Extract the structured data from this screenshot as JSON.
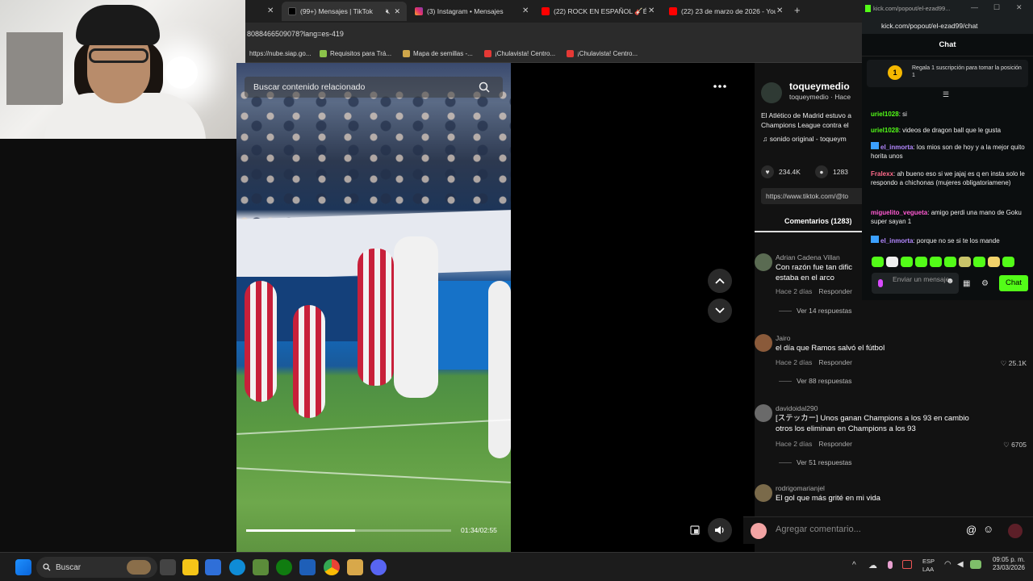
{
  "browser": {
    "tabs": [
      {
        "label": "(99+) Mensajes | TikTok",
        "active": true
      },
      {
        "label": "(3) Instagram • Mensajes",
        "active": false
      },
      {
        "label": "(22) ROCK EN ESPAÑOL 🎸ÉXI",
        "active": false
      },
      {
        "label": "(22) 23 de marzo de 2026 - You",
        "active": false
      }
    ],
    "url": "8088466509078?lang=es-419",
    "bookmarks": [
      "https://nube.siap.go...",
      "Requisitos para Trá...",
      "Mapa de semillas -...",
      "¡Chulavista! Centro...",
      "¡Chulavista! Centro..."
    ]
  },
  "video": {
    "search_placeholder": "Buscar contenido relacionado",
    "timecode": "01:34/02:55",
    "progress": 0.53
  },
  "tiktok": {
    "author_name": "toqueymedio",
    "author_sub": "toqueymedio · Hace",
    "description": "El Atlético de Madrid estuvo a Champions League contra el",
    "sound": "sonido original - toqueym",
    "likes": "234.4K",
    "comments_count": "1283",
    "link": "https://www.tiktok.com/@to",
    "comments_tab": "Comentarios (1283)",
    "comment_placeholder": "Agregar comentario...",
    "comments": [
      {
        "user": "Adrian Cadena Villan",
        "text": "Con razón fue tan dific estaba en el arco",
        "time": "Hace 2 días",
        "reply": "Responder",
        "likes": "",
        "replies": "Ver 14 respuestas"
      },
      {
        "user": "Jairo",
        "text": "el día que Ramos salvó el fútbol",
        "time": "Hace 2 días",
        "reply": "Responder",
        "likes": "25.1K",
        "replies": "Ver 88 respuestas"
      },
      {
        "user": "davidoidal290",
        "text": "[ステッカー] Unos ganan Champions a los 93 en cambio otros los eliminan en Champions a los 93",
        "time": "Hace 2 días",
        "reply": "Responder",
        "likes": "6705",
        "replies": "Ver 51 respuestas"
      },
      {
        "user": "rodrigomarianjel",
        "text": "El gol que más grité en mi vida",
        "time": "",
        "reply": "",
        "likes": "",
        "replies": ""
      }
    ]
  },
  "kick": {
    "titlebar": "kick.com/popout/el-ezad99...",
    "url": "kick.com/popout/el-ezad99/chat",
    "header": "Chat",
    "pinned": "Regala 1 suscripción para tomar la posición 1",
    "pinned_rank": "1",
    "messages": [
      {
        "user": "uriel1028",
        "color": "#53fc18",
        "text": ": si"
      },
      {
        "user": "uriel1028",
        "color": "#53fc18",
        "text": ": videos de dragon ball que le gusta"
      },
      {
        "user": "el_inmorta",
        "color": "#b388ff",
        "text": ": los mios son de hoy y a la mejor quito horita unos"
      },
      {
        "user": "Fralexx",
        "color": "#ff6b8b",
        "text": ": ah bueno eso si we jajaj es q en insta solo le respondo a chichonas (mujeres obligatoriamene)"
      },
      {
        "user": "miguelito_vegueta",
        "color": "#ff5ad2",
        "text": ": amigo perdi una mano de Goku super sayan 1"
      },
      {
        "user": "el_inmorta",
        "color": "#b388ff",
        "text": ": porque no se si te los mande"
      }
    ],
    "send_placeholder": "Enviar un mensaje",
    "chat_button": "Chat"
  },
  "taskbar": {
    "search": "Buscar",
    "lang": "ESP\nLAA",
    "time": "09:05 p. m.",
    "date": "23/03/2026"
  },
  "colors": {
    "kick_green": "#53fc18",
    "tiktok_red": "#fe2c55"
  }
}
